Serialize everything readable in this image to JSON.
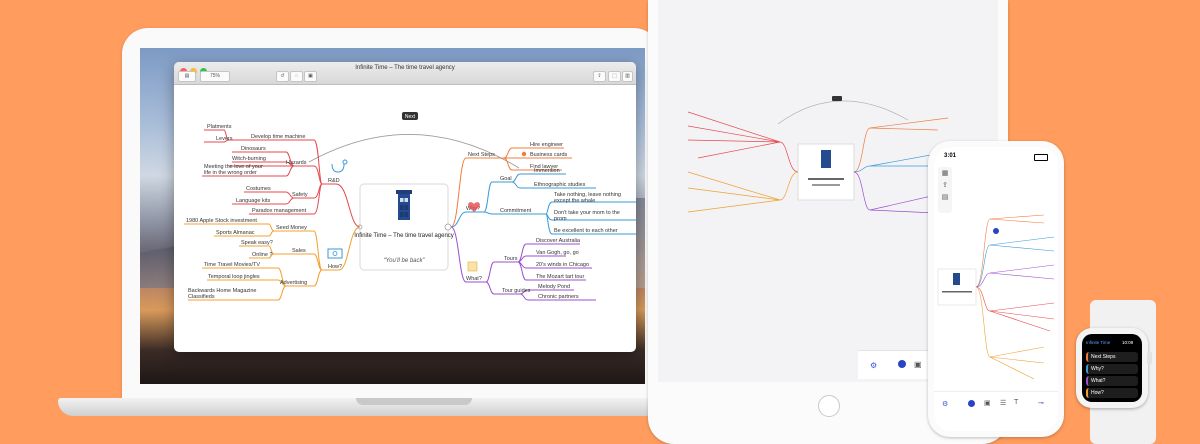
{
  "mac": {
    "window_title": "Infinite Time – The time travel agency",
    "zoom": "75%"
  },
  "mindmap": {
    "center_title": "Infinite Time – The time travel agency",
    "center_subtitle": "“You’ll be back”",
    "next_label": "Next",
    "left": {
      "rd": {
        "label": "R&D",
        "develop": "Develop time machine",
        "platments": "Platments",
        "levers": "Levers",
        "hazards": "Hazards",
        "dinosaurs": "Dinosaurs",
        "witch": "Witch-burning",
        "meeting_1": "Meeting the love of your",
        "meeting_2": "life in the wrong order",
        "safety": "Safety",
        "costumes": "Costumes",
        "language": "Language kits",
        "paradox": "Paradox management"
      },
      "how": {
        "label": "How?",
        "apple": "1980 Apple Stock investment",
        "seed": "Seed Money",
        "almanac": "Sports Almanac",
        "sales": "Sales",
        "speak": "Speak easy?",
        "online": "Online ?",
        "advertising": "Advertising",
        "ttm": "Time Travel Movies/TV",
        "jingles": "Temporal loop jingles",
        "backwards_1": "Backwards Home Magazine",
        "backwards_2": "Classifieds"
      }
    },
    "right": {
      "next_steps": {
        "label": "Next Steps",
        "hire": "Hire engineer",
        "cards": "Business cards",
        "lawyer": "Find lawyer"
      },
      "why": {
        "label": "Why?",
        "goal": "Goal",
        "immersion": "Immersion",
        "ethno": "Ethnographic studies",
        "commitment": "Commitment",
        "take_1": "Take nothing, leave nothing",
        "take_2": "except the whale",
        "mom_1": "Don't take your mom to the",
        "mom_2": "prom",
        "excellent": "Be excellent to each other"
      },
      "what": {
        "label": "What?",
        "tours": "Tours",
        "australia": "Discover Australia",
        "vangogh": "Van Gogh, go, go",
        "chicago": "20's winds in Chicago",
        "mozart": "The Mozart tart tour",
        "guides": "Tour guides",
        "melody": "Melody Pond",
        "chronic": "Chronic partners"
      }
    }
  },
  "iphone": {
    "time": "3:01"
  },
  "watch": {
    "app_name": "Infinite Time",
    "time": "10:09",
    "items": [
      "Next Steps",
      "Why?",
      "What?",
      "How?"
    ]
  },
  "colors": {
    "background": "#ff9c5e",
    "rd": "#e5484d",
    "how": "#f0a030",
    "next_steps": "#f07c3c",
    "why": "#3a9ad9",
    "what": "#9b4fd0"
  }
}
